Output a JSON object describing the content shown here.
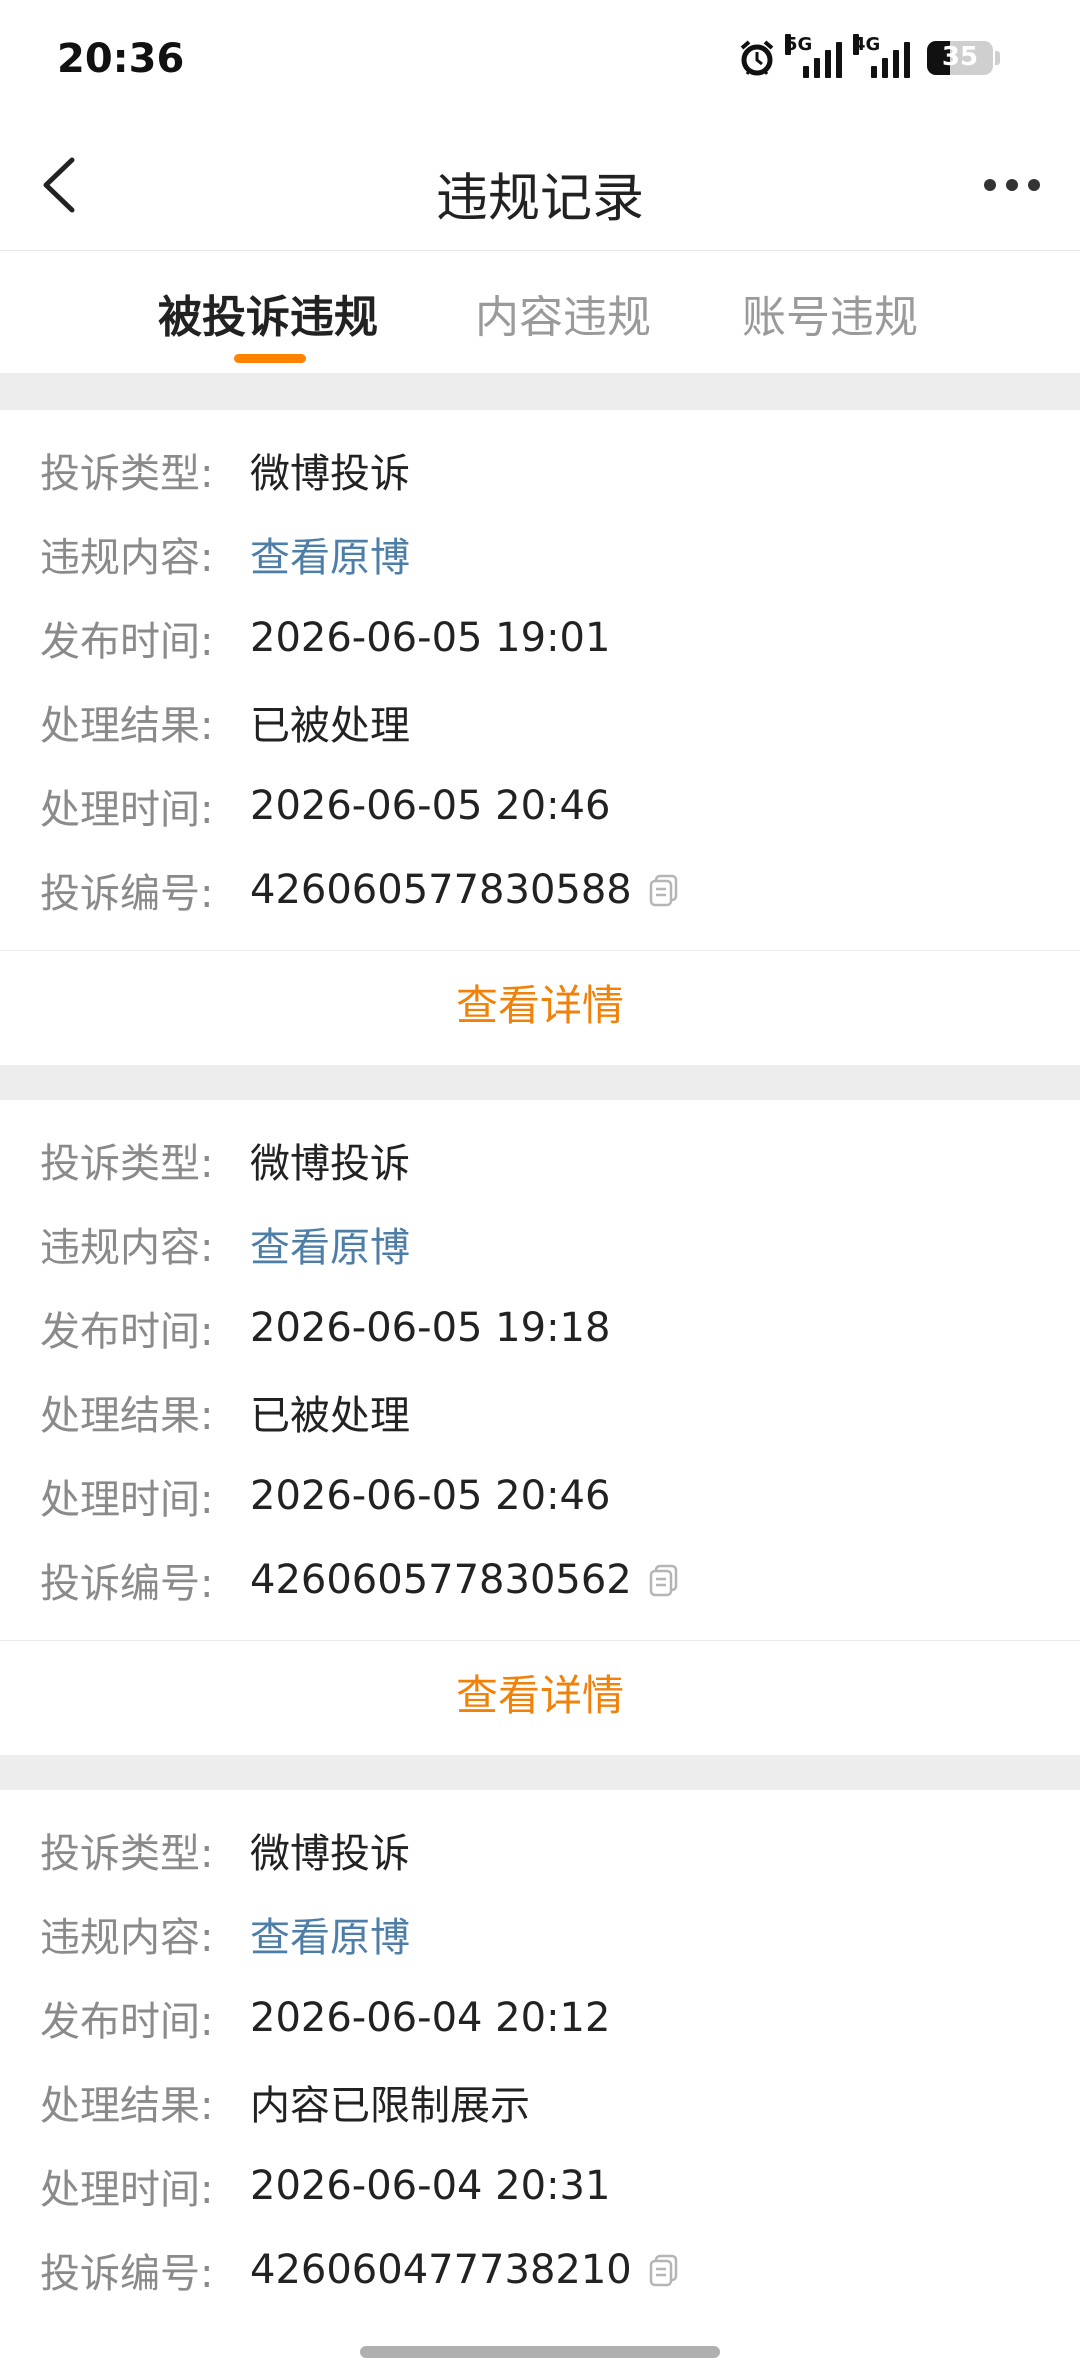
{
  "status": {
    "time": "20:36",
    "net1": "5G",
    "net2": "4G",
    "battery": "35",
    "battery_level": 0.35
  },
  "nav": {
    "title": "违规记录"
  },
  "tabs": [
    {
      "label": "被投诉违规",
      "active": true
    },
    {
      "label": "内容违规",
      "active": false
    },
    {
      "label": "账号违规",
      "active": false
    }
  ],
  "labels": {
    "type": "投诉类型:",
    "content": "违规内容:",
    "published": "发布时间:",
    "result": "处理结果:",
    "handled": "处理时间:",
    "id": "投诉编号:"
  },
  "records": [
    {
      "type": "微博投诉",
      "content": "查看原博",
      "published": "2026-06-05 19:01",
      "result": "已被处理",
      "handled": "2026-06-05 20:46",
      "id": "426060577830588",
      "detail": "查看详情"
    },
    {
      "type": "微博投诉",
      "content": "查看原博",
      "published": "2026-06-05 19:18",
      "result": "已被处理",
      "handled": "2026-06-05 20:46",
      "id": "426060577830562",
      "detail": "查看详情"
    },
    {
      "type": "微博投诉",
      "content": "查看原博",
      "published": "2026-06-04 20:12",
      "result": "内容已限制展示",
      "handled": "2026-06-04 20:31",
      "id": "426060477738210"
    }
  ],
  "colors": {
    "accent": "#ff8200",
    "link": "#4d7ea8",
    "label": "#8a8a8a"
  }
}
